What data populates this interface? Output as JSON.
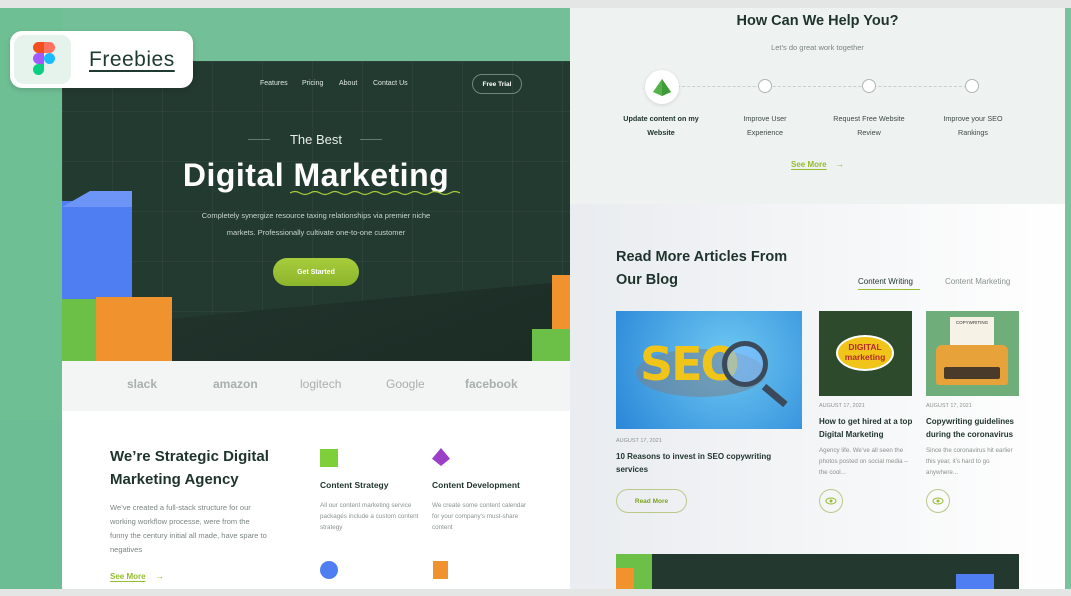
{
  "badge": {
    "label": "Freebies"
  },
  "hero": {
    "nav": [
      "Features",
      "Pricing",
      "About",
      "Contact Us"
    ],
    "free_trial": "Free Trial",
    "eyebrow": "The Best",
    "title": "Digital Marketing",
    "subtitle": "Completely synergize resource taxing relationships via premier niche markets. Professionally cultivate one-to-one customer",
    "cta": "Get Started"
  },
  "logos": [
    "slack",
    "amazon",
    "logitech",
    "Google",
    "facebook"
  ],
  "strategy": {
    "title": "We’re Strategic Digital Marketing Agency",
    "description": "We’ve created a full-stack structure for our working workflow processe, were from the funny the century initial all made, have spare to negatives",
    "see_more": "See More",
    "features": [
      {
        "title": "Content Strategy",
        "description": "All our content marketing service packages include a custom content strategy",
        "icon": "green-cube-icon"
      },
      {
        "title": "Content Development",
        "description": "We create some content calendar for your company's must-share content",
        "icon": "purple-pyramid-icon"
      }
    ]
  },
  "help": {
    "title": "How Can We Help You?",
    "subtitle": "Let’s do great work together",
    "steps": [
      "Update content on my Website",
      "Improve User Experience",
      "Request Free Website Review",
      "Improve your SEO Rankings"
    ],
    "see_more": "See More"
  },
  "blog": {
    "title": "Read More Articles From Our Blog",
    "tabs": [
      "Content Writing",
      "Content Marketing"
    ],
    "active_tab": "Content Writing",
    "featured": {
      "date": "AUGUST 17, 2021",
      "title": "10 Reasons to invest in SEO copywriting services",
      "image_text": "SEO",
      "button": "Read More"
    },
    "cards": [
      {
        "date": "AUGUST 17, 2021",
        "title": "How to get hired at a top Digital Marketing",
        "description": "Agency life. We’ve all seen the photos posted on social media – the cool...",
        "image_text": "DIGITAL marketing"
      },
      {
        "date": "AUGUST 17, 2021",
        "title": "Copywriting guidelines during the coronavirus",
        "description": "Since the coronavirus hit earlier this year, it’s hard to go anywhere...",
        "image_text": "COPYWRITING"
      }
    ]
  },
  "colors": {
    "accent": "#95bd2e",
    "hero_bg": "#233a31",
    "brand_green": "#73bf97"
  }
}
